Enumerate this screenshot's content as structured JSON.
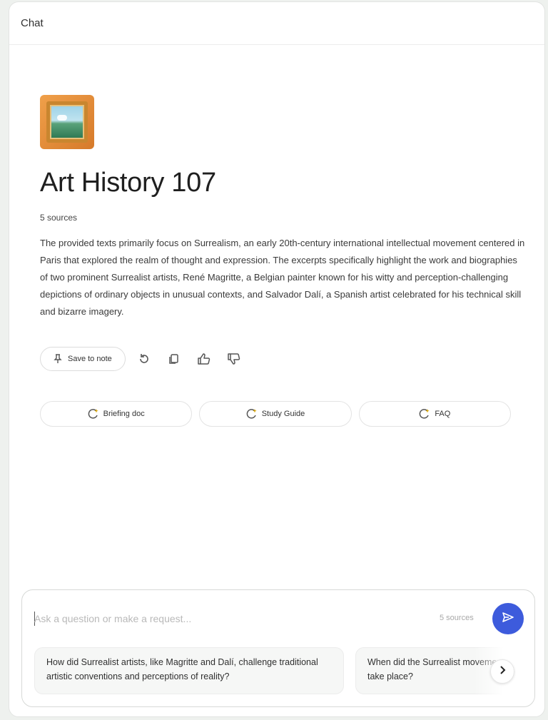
{
  "panel": {
    "title": "Chat"
  },
  "notebook": {
    "icon": "framed-painting-icon",
    "title": "Art History 107",
    "source_count": "5 sources",
    "summary": "The provided texts primarily focus on Surrealism, an early 20th-century international intellectual movement centered in Paris that explored the realm of thought and expression. The excerpts specifically highlight the work and biographies of two prominent Surrealist artists, René Magritte, a Belgian painter known for his witty and perception-challenging depictions of ordinary objects in unusual contexts, and Salvador Dalí, a Spanish artist celebrated for his technical skill and bizarre imagery."
  },
  "actions": {
    "save_label": "Save to note",
    "save_icon": "pin-icon",
    "regenerate_icon": "refresh-icon",
    "copy_icon": "copy-icon",
    "like_icon": "thumbs-up-icon",
    "dislike_icon": "thumbs-down-icon"
  },
  "chips": [
    {
      "label": "Briefing doc",
      "icon": "note-spark-icon"
    },
    {
      "label": "Study Guide",
      "icon": "note-spark-icon"
    },
    {
      "label": "FAQ",
      "icon": "note-spark-icon"
    }
  ],
  "composer": {
    "placeholder": "Ask a question or make a request...",
    "sources_label": "5 sources",
    "send_icon": "send-icon",
    "send_color": "#3d5bdc",
    "suggestions": [
      "How did Surrealist artists, like Magritte and Dalí, challenge traditional artistic conventions and perceptions of reality?",
      "When did the Surrealist movement primarily take place?"
    ],
    "scroll_icon": "chevron-right-icon"
  }
}
